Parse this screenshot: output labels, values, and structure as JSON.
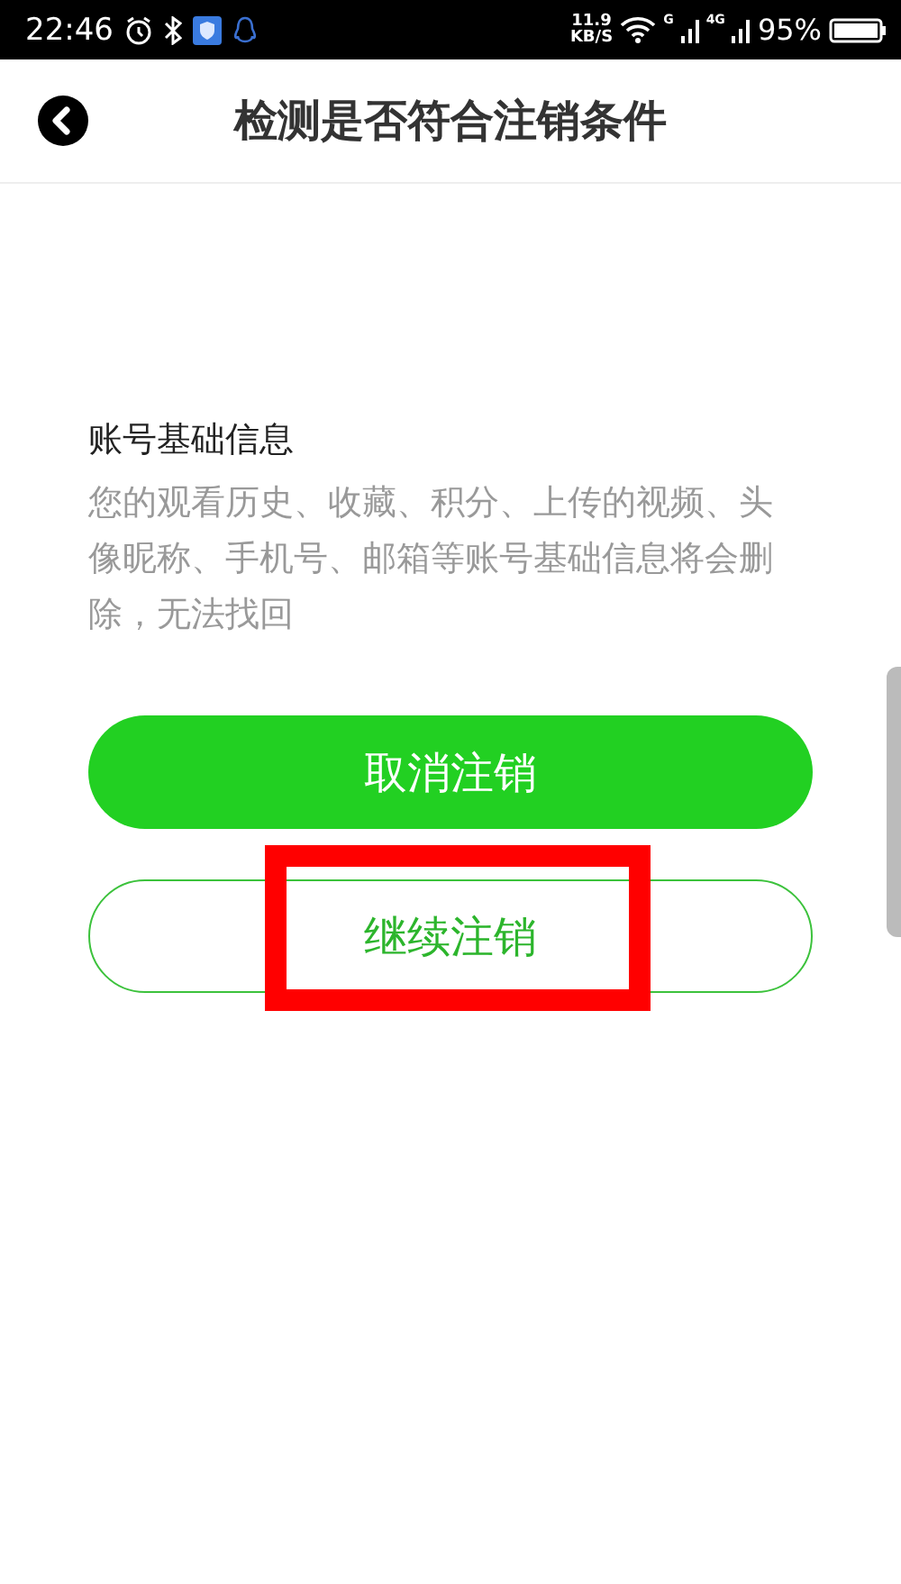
{
  "status_bar": {
    "time": "22:46",
    "speed_value": "11.9",
    "speed_unit": "KB/S",
    "sim1_network": "G",
    "sim2_network": "4G",
    "battery": "95%"
  },
  "header": {
    "title": "检测是否符合注销条件"
  },
  "section": {
    "heading": "账号基础信息",
    "description": "您的观看历史、收藏、积分、上传的视频、头像昵称、手机号、邮箱等账号基础信息将会删除，无法找回"
  },
  "buttons": [
    {
      "label": "取消注销",
      "kind": "primary"
    },
    {
      "label": "继续注销",
      "kind": "outline",
      "highlighted": true
    }
  ]
}
